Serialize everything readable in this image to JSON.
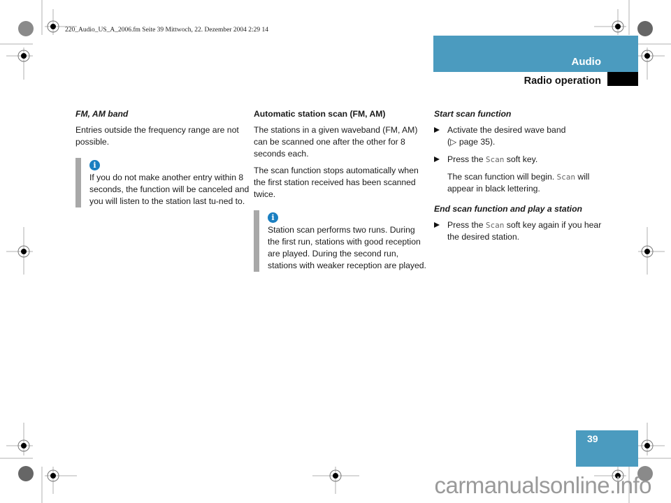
{
  "file_header": "220_Audio_US_A_2006.fm  Seite 39  Mittwoch, 22. Dezember 2004  2:29 14",
  "header": {
    "section": "Audio",
    "subsection": "Radio operation",
    "accent_color": "#4b9bbf"
  },
  "page_number": "39",
  "column1": {
    "heading": "FM, AM band",
    "paragraph": "Entries outside the frequency range are not possible.",
    "note": {
      "icon": "info-icon",
      "text": "If you do not make another entry within 8 seconds, the function will be canceled and you will listen to the station last tu-ned to."
    }
  },
  "column2": {
    "heading": "Automatic station scan (FM, AM)",
    "paragraphs": [
      "The stations in a given waveband (FM, AM) can be scanned one after the other for 8 seconds each.",
      "The scan function stops automatically when the first station received has been scanned twice."
    ],
    "note": {
      "icon": "info-icon",
      "text": "Station scan performs two runs. During the first run, stations with good reception are played. During the second run, stations with weaker reception are played."
    }
  },
  "column3": {
    "start_heading": "Start scan function",
    "step1_a": "Activate the desired wave band",
    "step1_b": "(▷ page 35).",
    "step2_pre": "Press the ",
    "step2_key": "Scan",
    "step2_post": " soft key.",
    "result_pre": "The scan function will begin. ",
    "result_key": "Scan",
    "result_post": " will appear in black lettering.",
    "end_heading": "End scan function and play a station",
    "step3_pre": "Press the ",
    "step3_key": "Scan",
    "step3_post": " soft key again if you hear the desired station."
  },
  "watermark": "carmanualsonline.info"
}
